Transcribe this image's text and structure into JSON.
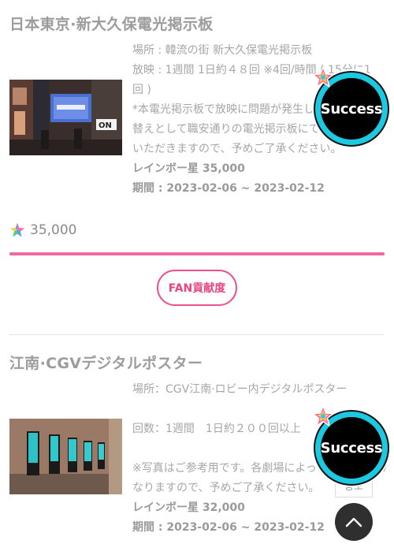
{
  "sections": [
    {
      "title": "日本東京·新大久保電光掲示板",
      "info_lines": [
        "場所 : 韓流の街 新大久保電光掲示板",
        "放映 : 1週間 1日約４８回 ※4回/時間 ( 15分に1",
        "回 )",
        "*本電光掲示板で放映に問題が発生した場合、差し",
        "替えとして職安通りの電光掲示板にて放映させて",
        "いただきますので、予めご了承ください。"
      ],
      "price": "レインボー星 35,000",
      "period": "期間 : 2023-02-06 ~ 2023-02-12",
      "badge": "Success"
    },
    {
      "title": "江南·CGVデジタルポスター",
      "info_lines": [
        "場所：CGV江南·ロビー内デジタルポスター",
        "",
        "回数：1週間　1日約２００回以上",
        "",
        "※写真はご参考用です。各劇場によって異なる場合が",
        "なりますので、予めご了承ください。"
      ],
      "price": "レインボー星 32,000",
      "period": "期間 : 2023-02-06 ~ 2023-02-12",
      "badge": "Success"
    }
  ],
  "points": "35,000",
  "progress": 1.0,
  "fan_button": "FAN貢献度",
  "apply_button": "응모",
  "colors": {
    "accent": "#ee4f8f",
    "badge_ring": "#1cc9e0"
  }
}
